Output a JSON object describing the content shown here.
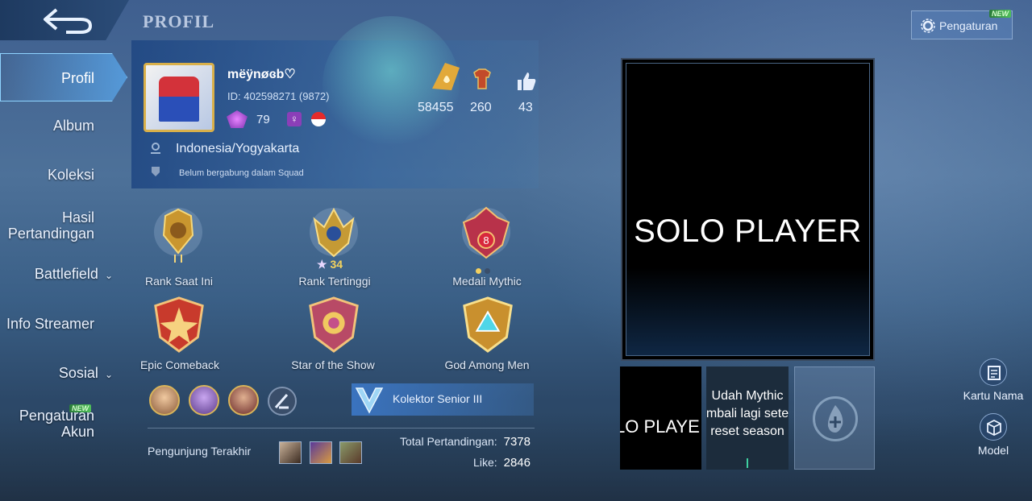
{
  "header": {
    "title": "PROFIL"
  },
  "sidebar": {
    "items": [
      {
        "label": "Profil"
      },
      {
        "label": "Album"
      },
      {
        "label": "Koleksi"
      },
      {
        "label": "Hasil\nPertandingan"
      },
      {
        "label": "Battlefield"
      },
      {
        "label": "Info Streamer"
      },
      {
        "label": "Sosial"
      },
      {
        "label": "Pengaturan\nAkun"
      }
    ],
    "new_badge": "NEW"
  },
  "profile": {
    "username": "mëÿnøɞb♡",
    "id": "ID: 402598271 (9872)",
    "level": "79",
    "location": "Indonesia/Yogyakarta",
    "squad": "Belum bergabung dalam Squad",
    "top_stats": {
      "popularity": "58455",
      "skins": "260",
      "likes": "43"
    }
  },
  "medals": {
    "rank_current": "Rank Saat Ini",
    "rank_highest": "Rank Tertinggi",
    "rank_highest_stars": "34",
    "mythic_medal": "Medali Mythic",
    "mythic_level": "8",
    "epic_comeback": "Epic Comeback",
    "star_of_show": "Star of the Show",
    "god_among_men": "God Among Men"
  },
  "collector": {
    "label": "Kolektor Senior III"
  },
  "visitors": {
    "label": "Pengunjung Terakhir"
  },
  "totals": {
    "matches_label": "Total Pertandingan:",
    "matches_value": "7378",
    "likes_label": "Like:",
    "likes_value": "2846"
  },
  "showcase": {
    "main_text": "SOLO PLAYER",
    "thumb1_text": "LO PLAYE",
    "thumb2_lines": [
      "Udah Mythic",
      "mbali lagi sete",
      "reset season"
    ]
  },
  "settings": {
    "label": "Pengaturan",
    "badge": "NEW"
  },
  "right_buttons": {
    "name_card": "Kartu Nama",
    "model": "Model"
  }
}
